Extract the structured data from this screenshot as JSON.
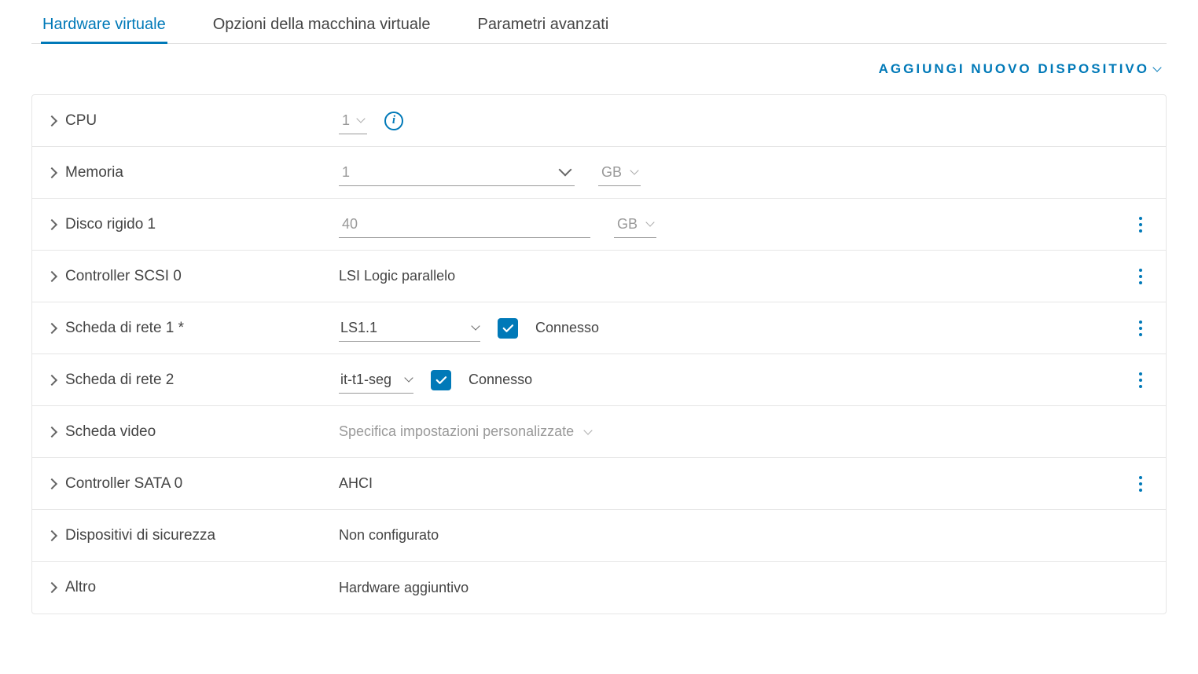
{
  "tabs": {
    "hardware": "Hardware virtuale",
    "options": "Opzioni della macchina virtuale",
    "advanced": "Parametri avanzati"
  },
  "add_device_label": "AGGIUNGI NUOVO DISPOSITIVO",
  "rows": {
    "cpu": {
      "label": "CPU",
      "value": "1"
    },
    "memory": {
      "label": "Memoria",
      "value": "1",
      "unit": "GB"
    },
    "disk1": {
      "label": "Disco rigido 1",
      "value": "40",
      "unit": "GB"
    },
    "scsi0": {
      "label": "Controller SCSI 0",
      "value": "LSI Logic parallelo"
    },
    "nic1": {
      "label": "Scheda di rete 1 *",
      "value": "LS1.1",
      "connected_label": "Connesso"
    },
    "nic2": {
      "label": "Scheda di rete 2",
      "value": "it-t1-seg",
      "connected_label": "Connesso"
    },
    "video": {
      "label": "Scheda video",
      "value": "Specifica impostazioni personalizzate"
    },
    "sata0": {
      "label": "Controller SATA 0",
      "value": "AHCI"
    },
    "security": {
      "label": "Dispositivi di sicurezza",
      "value": "Non configurato"
    },
    "other": {
      "label": "Altro",
      "value": "Hardware aggiuntivo"
    }
  },
  "info_glyph": "i"
}
